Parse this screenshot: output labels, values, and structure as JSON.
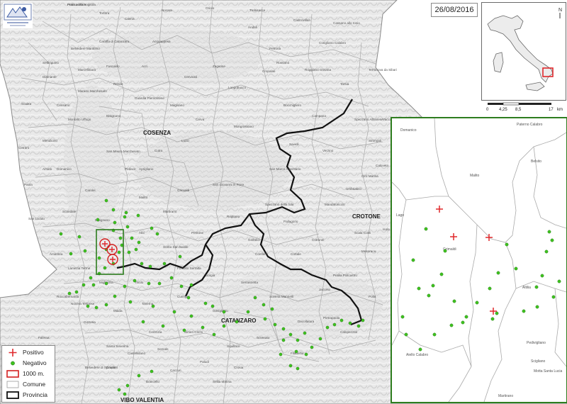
{
  "date": "26/08/2016",
  "legend": {
    "positive": "Positivo",
    "negative": "Negativo",
    "buffer": "1000 m.",
    "comune": "Comune",
    "provincia": "Provincia"
  },
  "scalebar": {
    "ticks": [
      "0",
      "4,25",
      "8,5",
      "17"
    ],
    "unit": "km"
  },
  "north_label": "N",
  "colors": {
    "positive": "#e0282c",
    "negative": "#3ec21f",
    "frame": "#2e7d1f",
    "province": "#111111",
    "buffer": "#d42020"
  },
  "main_labels": {
    "cosenza": "COSENZA",
    "crotone": "CROTONE",
    "catanzaro": "CATANZARO",
    "vibo": "VIBO VALENTIA",
    "comuni": [
      "Praia a Mare",
      "Aieta",
      "Tortora",
      "Canna",
      "Nocara",
      "Oriolo",
      "Trebisacce",
      "Castrovillari",
      "Cassano allo Ionio",
      "Corigliano Calabro",
      "Rossano",
      "Cropalati",
      "Longobucco",
      "Bocchigliero",
      "Campana",
      "Savelli",
      "Verzino",
      "Strongoli",
      "Cirò Marina",
      "Umbriatico",
      "Pallagorio",
      "Cotronei",
      "Petilia Policastro",
      "Mesoraca",
      "Isola di Capo Rizzuto",
      "Belvedere Marittimo",
      "Diamante",
      "Scalea",
      "Cetraro",
      "Paola",
      "San Lucido",
      "Amantea",
      "Rende",
      "Montalto Uffugo",
      "Bisignano",
      "Acri",
      "Luzzi",
      "Spezzano della Sila",
      "San Giovanni in Fiore",
      "Pedace",
      "Rogliano",
      "Aprigliano",
      "Nocera Terinese",
      "Lamezia Terme",
      "Falerna",
      "Gizzeria",
      "Maida",
      "Curinga",
      "Filadelfia",
      "Soverato",
      "Squillace",
      "Borgia",
      "Taverna",
      "Sersale",
      "Cropani",
      "Botricello",
      "Sellia Marina",
      "Simeri Crichi",
      "Tiriolo",
      "Gimigliano",
      "Decollatura",
      "Soveria Mannelli",
      "Serrastretta",
      "Conflenti",
      "Martirano",
      "Grimaldi",
      "Malito",
      "Dipignano",
      "Carolei",
      "Domanico",
      "Mendicino",
      "Cerisano",
      "Marano Marchesato",
      "Fuscaldo",
      "Guardia Piemontese",
      "Acquappesa",
      "Cervicati",
      "Mongrassano",
      "San Marco Argentano",
      "Roggiano Gravina",
      "Tarsia",
      "Terranova da Sibari",
      "Spezzano Albanese",
      "Vaccarizzo Albanese",
      "Caloveto",
      "Mandatoriccio",
      "Scala Coeli",
      "Pietrapaola",
      "Calopezzati",
      "Crosia",
      "Paludi",
      "Caccuri",
      "Cerenzia",
      "Castelsilano",
      "Belvedere di Spinello",
      "Santa Severina",
      "Roccabernarda",
      "Scandale",
      "San Mauro Marchesato",
      "Cutro",
      "Cerva",
      "Andali",
      "Petronà",
      "Zagarise",
      "Magisano",
      "Albi",
      "Sorbo San Basile",
      "Fossato Serralta",
      "Pentone",
      "Settingiano",
      "Caraffa di Catanzaro",
      "Marcellinara",
      "Amato",
      "Miglierina",
      "Girifalco",
      "Cortale",
      "Jacurso",
      "Polia",
      "Francavilla Angitola",
      "Pizzo"
    ]
  },
  "zoom_labels": [
    "Domanico",
    "Malito",
    "Belsito",
    "Paterno Calabro",
    "Lago",
    "Grimaldi",
    "Altilia",
    "Scigliano",
    "Aiello Calabro",
    "Pedivigliano",
    "Martirano",
    "Motta Santa Lucia"
  ],
  "points": {
    "main_negative_count": 93,
    "main_positive_count": 3,
    "zoom_positive_count": 4,
    "zoom_negative_count": 31
  }
}
